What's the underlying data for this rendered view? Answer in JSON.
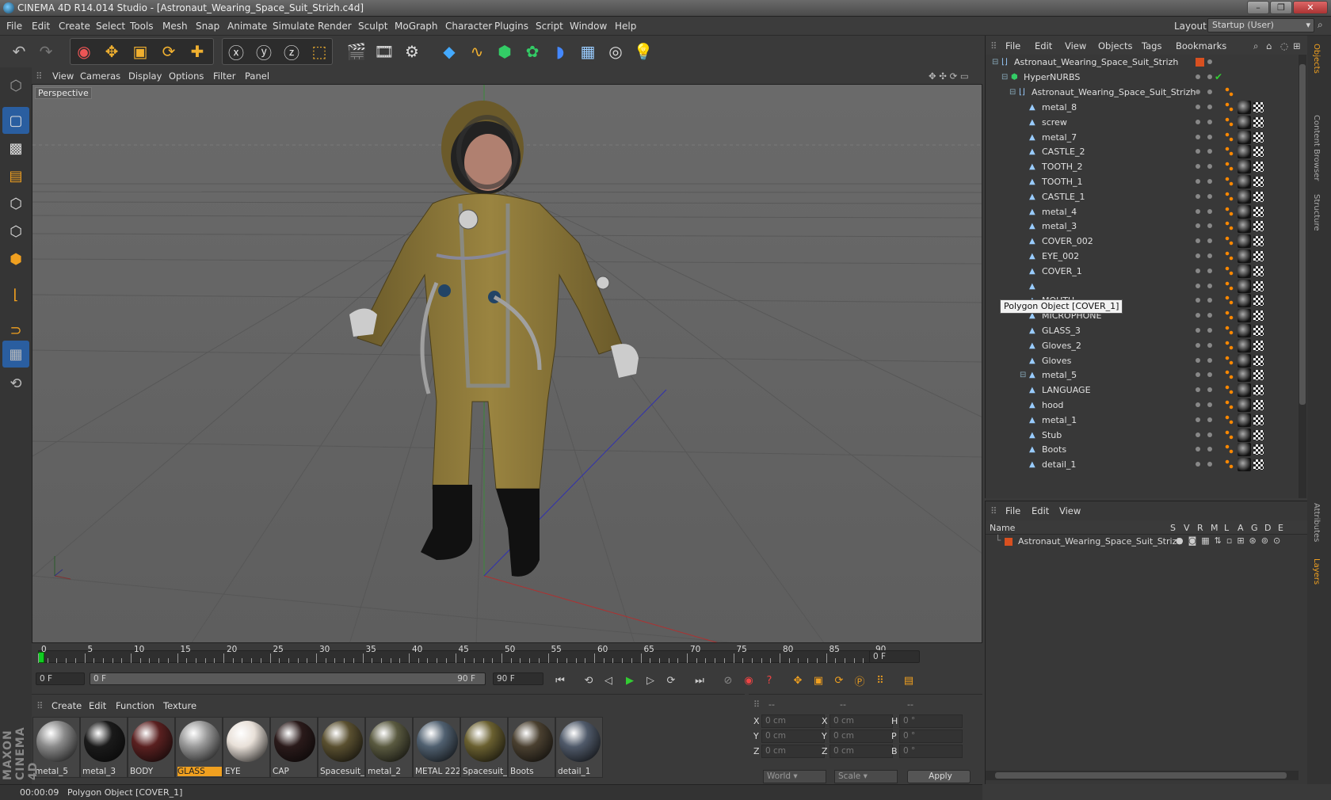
{
  "window": {
    "title": "CINEMA 4D R14.014 Studio - [Astronaut_Wearing_Space_Suit_Strizh.c4d]"
  },
  "menubar": {
    "items": [
      "File",
      "Edit",
      "Create",
      "Select",
      "Tools",
      "Mesh",
      "Snap",
      "Animate",
      "Simulate",
      "Render",
      "Sculpt",
      "MoGraph",
      "Character",
      "Plugins",
      "Script",
      "Window",
      "Help"
    ],
    "layout_label": "Layout:",
    "layout_value": "Startup (User)"
  },
  "viewport": {
    "menu": [
      "View",
      "Cameras",
      "Display",
      "Options",
      "Filter",
      "Panel"
    ],
    "label": "Perspective"
  },
  "timeline": {
    "ticks": [
      "0",
      "5",
      "10",
      "15",
      "20",
      "25",
      "30",
      "35",
      "40",
      "45",
      "50",
      "55",
      "60",
      "65",
      "70",
      "75",
      "80",
      "85",
      "90"
    ],
    "current_frame": "0 F"
  },
  "playbar": {
    "start": "0 F",
    "range_start": "0 F",
    "range_end": "90 F",
    "end": "90 F"
  },
  "materials": {
    "menu": [
      "Create",
      "Edit",
      "Function",
      "Texture"
    ],
    "items": [
      {
        "name": "metal_5",
        "color": "#8a8a8a"
      },
      {
        "name": "metal_3",
        "color": "#1a1a1a"
      },
      {
        "name": "BODY",
        "color": "#5a2020"
      },
      {
        "name": "GLASS",
        "color": "#9a9a9a",
        "selected": true
      },
      {
        "name": "EYE",
        "color": "#e8e0d8"
      },
      {
        "name": "CAP",
        "color": "#2a1a1a"
      },
      {
        "name": "Spacesuit_",
        "color": "#5a5030"
      },
      {
        "name": "metal_2",
        "color": "#5a5a40"
      },
      {
        "name": "METAL 222.",
        "color": "#506070"
      },
      {
        "name": "Spacesuit_",
        "color": "#6a6030"
      },
      {
        "name": "Boots",
        "color": "#4a4030"
      },
      {
        "name": "detail_1",
        "color": "#505a6a"
      }
    ]
  },
  "coords": {
    "headers": [
      "--",
      "--",
      "--"
    ],
    "rows": [
      {
        "a": "X",
        "av": "0 cm",
        "b": "X",
        "bv": "0 cm",
        "c": "H",
        "cv": "0 °"
      },
      {
        "a": "Y",
        "av": "0 cm",
        "b": "Y",
        "bv": "0 cm",
        "c": "P",
        "cv": "0 °"
      },
      {
        "a": "Z",
        "av": "0 cm",
        "b": "Z",
        "bv": "0 cm",
        "c": "B",
        "cv": "0 °"
      }
    ],
    "world": "World",
    "scale": "Scale",
    "apply": "Apply"
  },
  "status": {
    "time": "00:00:09",
    "text": "Polygon Object [COVER_1]"
  },
  "objects": {
    "menu": [
      "File",
      "Edit",
      "View",
      "Objects",
      "Tags",
      "Bookmarks"
    ],
    "root": "Astronaut_Wearing_Space_Suit_Strizh",
    "nurbs": "HyperNURBS",
    "group": "Astronaut_Wearing_Space_Suit_Strizh",
    "items": [
      "metal_8",
      "screw",
      "metal_7",
      "CASTLE_2",
      "TOOTH_2",
      "TOOTH_1",
      "CASTLE_1",
      "metal_4",
      "metal_3",
      "COVER_002",
      "EYE_002",
      "COVER_1",
      "",
      "MOUTH",
      "MICROPHONE",
      "GLASS_3",
      "Gloves_2",
      "Gloves",
      "metal_5",
      "LANGUAGE",
      "hood",
      "metal_1",
      "Stub",
      "Boots",
      "detail_1"
    ],
    "tooltip": "Polygon Object [COVER_1]"
  },
  "layers": {
    "menu": [
      "File",
      "Edit",
      "View"
    ],
    "columns": [
      "Name",
      "S",
      "V",
      "R",
      "M",
      "L",
      "A",
      "G",
      "D",
      "E"
    ],
    "row": "Astronaut_Wearing_Space_Suit_Strizh"
  },
  "side_tabs": [
    "Objects",
    "Content Browser",
    "Structure",
    "Attributes",
    "Layers"
  ],
  "brand": "MAXON CINEMA 4D"
}
